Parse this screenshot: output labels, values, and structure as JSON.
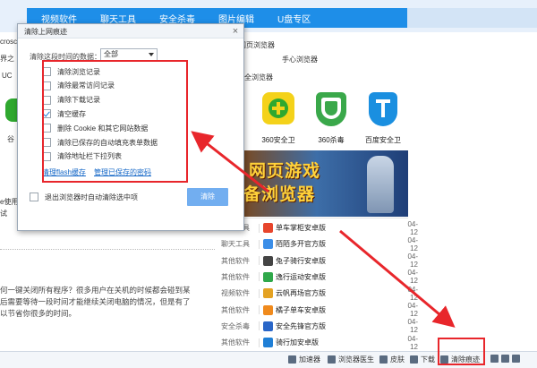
{
  "nav": {
    "items": [
      "视频软件",
      "聊天工具",
      "安全杀毒",
      "图片编辑",
      "U盘专区"
    ]
  },
  "page_fragments": {
    "crosc": "crosc",
    "jie": "界之",
    "uc": "UC",
    "gu": "谷",
    "use": "e使用",
    "shi": "试",
    "wang": "网页浏览器",
    "shouxin": "手心浏览器",
    "quan": "全浏览器"
  },
  "apps": [
    {
      "label": "360安全卫",
      "color": "#2fa82f"
    },
    {
      "label": "360杀毒",
      "color": "#3aa84a"
    },
    {
      "label": "百度安全卫",
      "color": "#1a8fe0"
    }
  ],
  "banner": {
    "line1": "网页游戏",
    "line2": "备浏览器"
  },
  "downloads": [
    {
      "category": "聊天工具",
      "name": "单车掌柜安卓版",
      "date": "04-12",
      "icon": "#e7452c"
    },
    {
      "category": "聊天工具",
      "name": "陌陌多开官方版",
      "date": "04-12",
      "icon": "#3b8ee8"
    },
    {
      "category": "其他软件",
      "name": "兔子骑行安卓版",
      "date": "04-12",
      "icon": "#444444"
    },
    {
      "category": "其他软件",
      "name": "逸行运动安卓版",
      "date": "04-12",
      "icon": "#2fa84a"
    },
    {
      "category": "视频软件",
      "name": "云帆再场官方版",
      "date": "04-12",
      "icon": "#e4a223"
    },
    {
      "category": "其他软件",
      "name": "橘子单车安卓版",
      "date": "04-12",
      "icon": "#f08a1c"
    },
    {
      "category": "安全杀毒",
      "name": "安全先锋官方版",
      "date": "04-12",
      "icon": "#2a66c8"
    },
    {
      "category": "其他软件",
      "name": "骑行加安卓版",
      "date": "04-12",
      "icon": "#1f7fd6"
    }
  ],
  "article": {
    "line1": "何一键关闭所有程序？很多用户在关机的时候都会碰到某",
    "line2": "后需要等待一段时间才能继续关闭电脑的情况，但是有了",
    "line3": "以节省你很多的时间。"
  },
  "statusbar": {
    "items": [
      "加速器",
      "浏览器医生",
      "皮肤",
      "下载",
      "清除痕迹"
    ]
  },
  "dialog": {
    "title": "清除上网痕迹",
    "close": "×",
    "range_label": "清除这段时间的数据：",
    "range_value": "全部",
    "options": [
      {
        "label": "清除浏览记录",
        "checked": false
      },
      {
        "label": "清除最常访问记录",
        "checked": false
      },
      {
        "label": "清除下载记录",
        "checked": false
      },
      {
        "label": "清空缓存",
        "checked": true
      },
      {
        "label": "删除 Cookie 和其它网站数据",
        "checked": false
      },
      {
        "label": "清除已保存的自动填充表单数据",
        "checked": false
      },
      {
        "label": "清除地址栏下拉列表",
        "checked": false
      }
    ],
    "link_flash": "清理flash缓存",
    "link_passwords": "管理已保存的密码",
    "exit_option": "退出浏览器时自动清除选中项",
    "clear_button": "清除"
  }
}
